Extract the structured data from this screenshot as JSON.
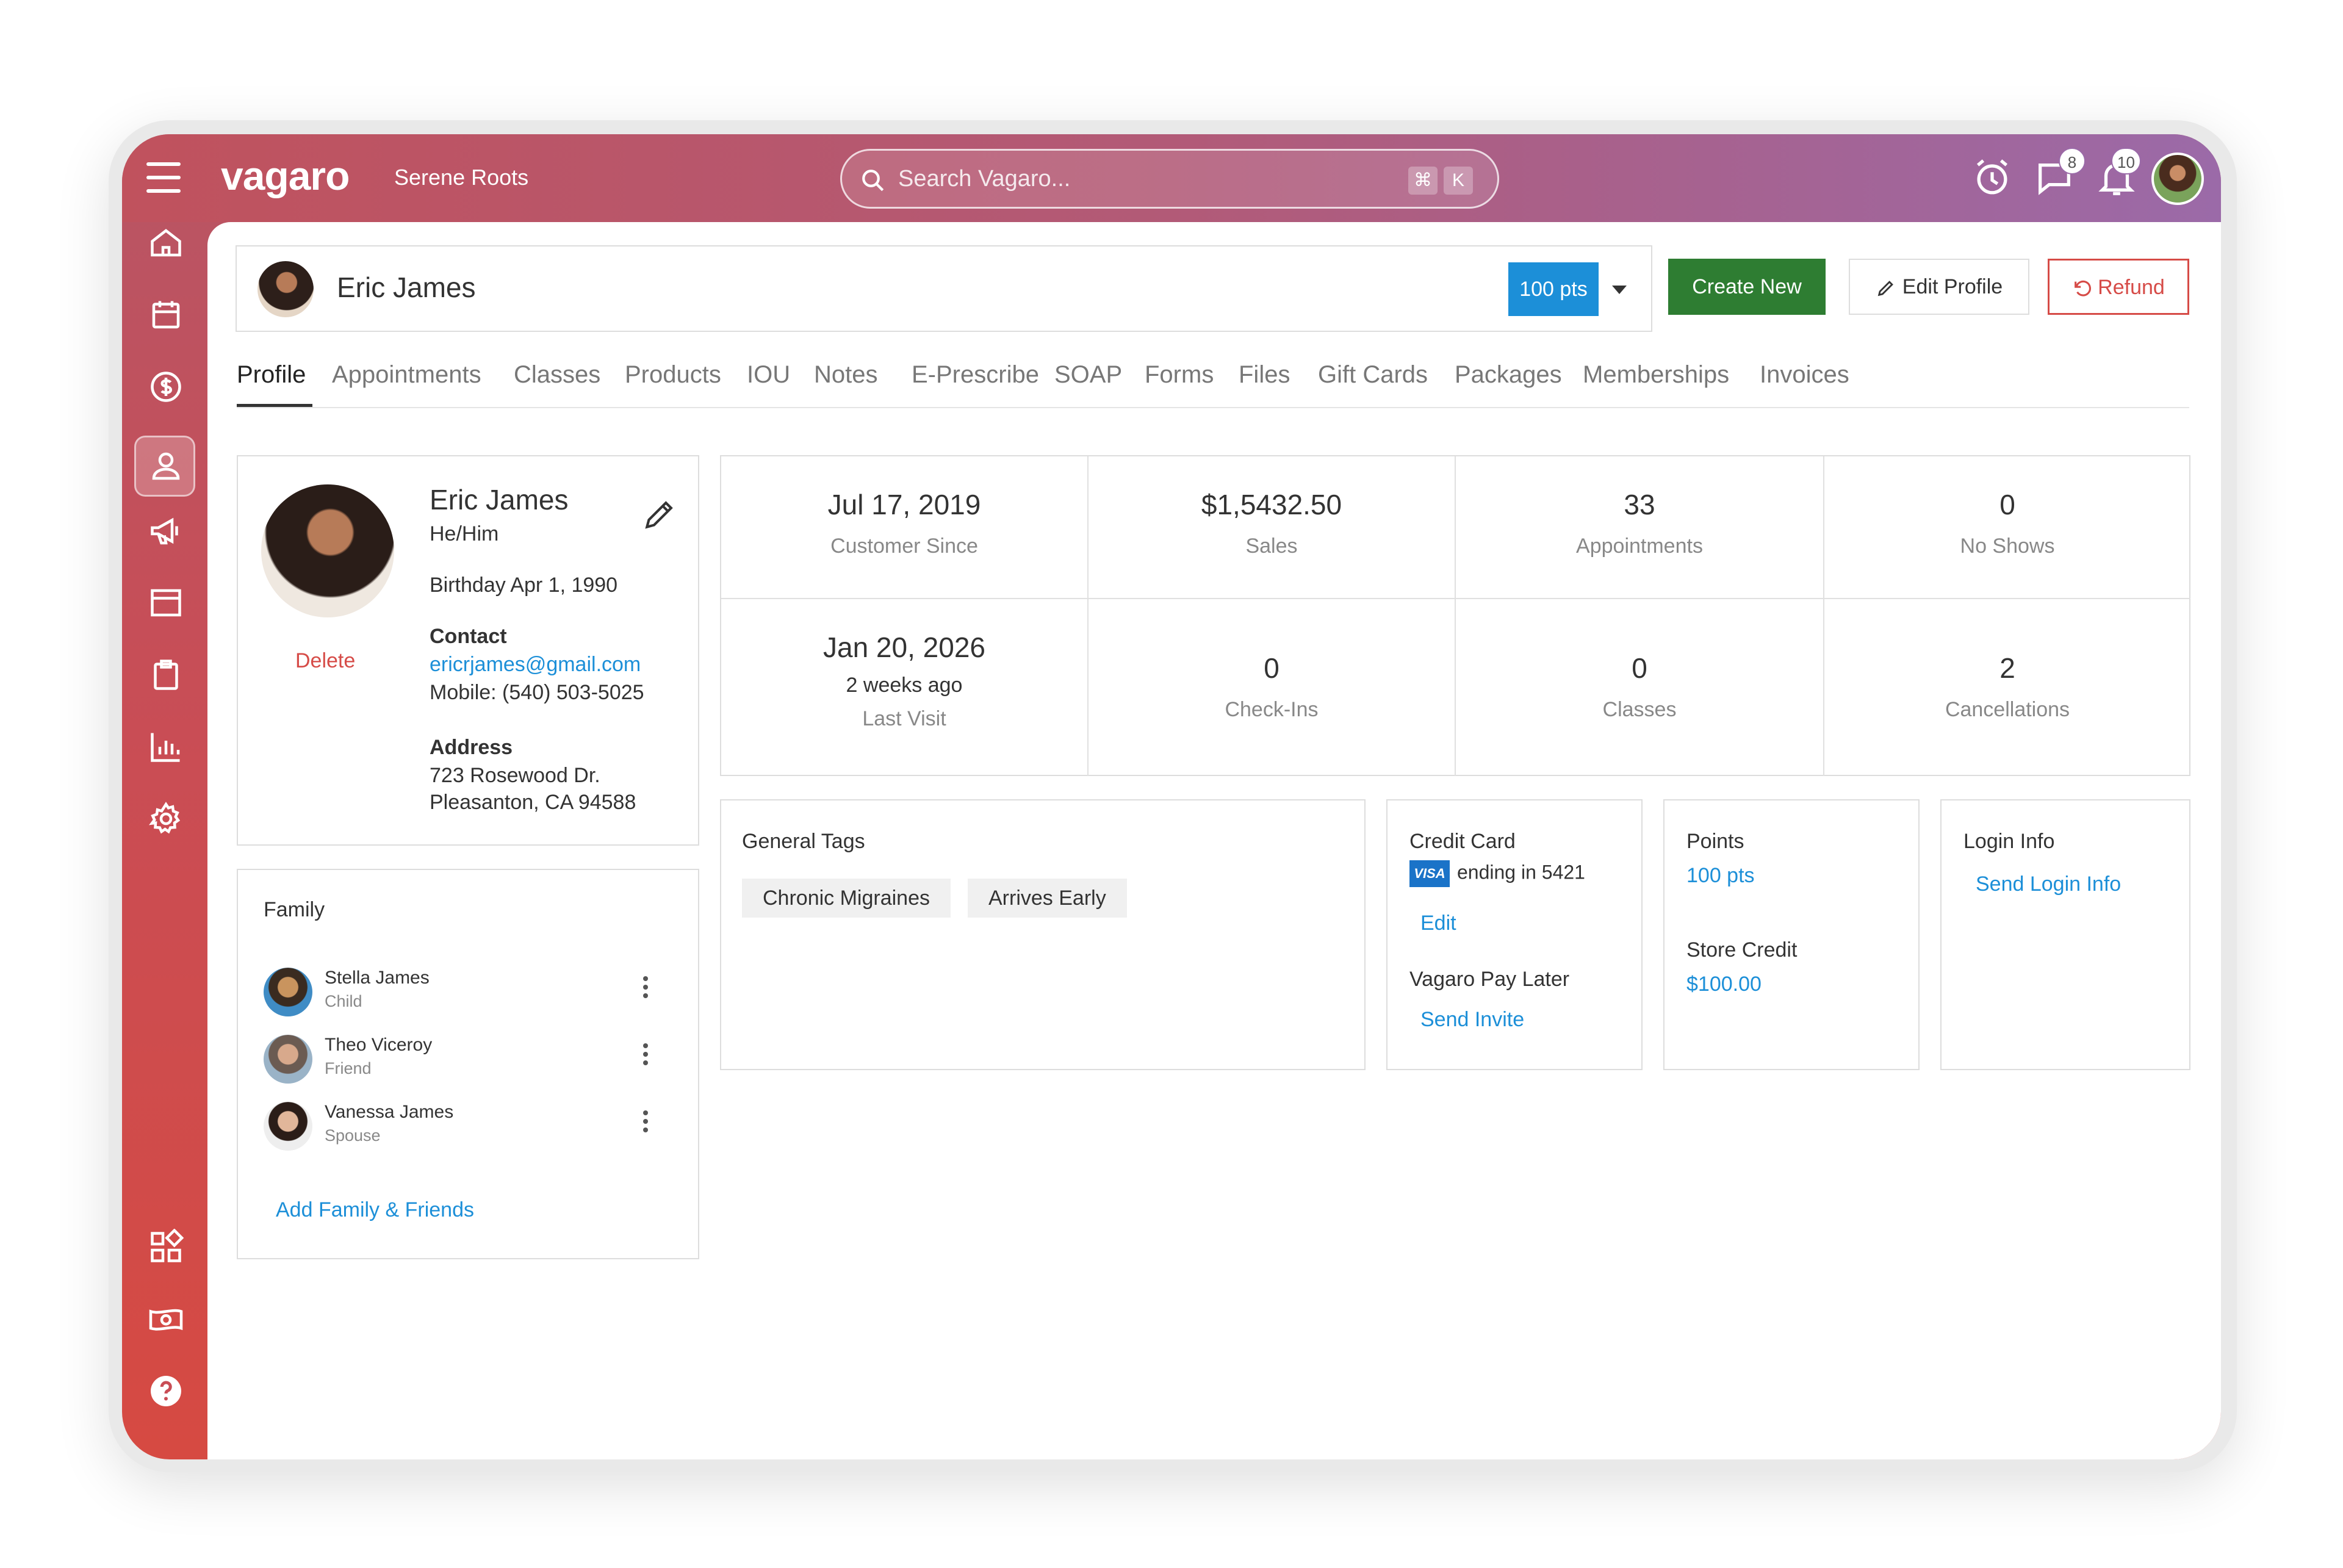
{
  "app": {
    "logo": "vagaro",
    "business_name": "Serene Roots",
    "search_placeholder": "Search Vagaro...",
    "search_shortcut": [
      "⌘",
      "K"
    ],
    "messages_count": "8",
    "notifications_count": "10"
  },
  "sidebar": {
    "items": [
      {
        "icon": "home-icon"
      },
      {
        "icon": "calendar-icon"
      },
      {
        "icon": "dollar-icon"
      },
      {
        "icon": "customer-icon",
        "active": true
      },
      {
        "icon": "megaphone-icon"
      },
      {
        "icon": "browser-window-icon"
      },
      {
        "icon": "clipboard-icon"
      },
      {
        "icon": "bar-chart-icon"
      },
      {
        "icon": "gear-icon"
      },
      {
        "icon": "apps-grid-icon"
      },
      {
        "icon": "cash-icon"
      },
      {
        "icon": "help-icon"
      }
    ]
  },
  "header": {
    "customer_name": "Eric James",
    "points_button": "100 pts",
    "create_new": "Create New",
    "edit_profile": "Edit Profile",
    "refund": "Refund"
  },
  "tabs": [
    "Profile",
    "Appointments",
    "Classes",
    "Products",
    "IOU",
    "Notes",
    "E-Prescribe",
    "SOAP",
    "Forms",
    "Files",
    "Gift Cards",
    "Packages",
    "Memberships",
    "Invoices"
  ],
  "profile": {
    "name": "Eric James",
    "pronouns": "He/Him",
    "birthday": "Birthday Apr 1, 1990",
    "delete": "Delete",
    "contact_heading": "Contact",
    "email": "ericrjames@gmail.com",
    "mobile": "Mobile: (540) 503-5025",
    "address_heading": "Address",
    "address_line1": "723 Rosewood Dr.",
    "address_line2": "Pleasanton, CA 94588"
  },
  "stats": {
    "customer_since": {
      "value": "Jul 17, 2019",
      "label": "Customer Since"
    },
    "sales": {
      "value": "$1,5432.50",
      "label": "Sales"
    },
    "appointments": {
      "value": "33",
      "label": "Appointments"
    },
    "no_shows": {
      "value": "0",
      "label": "No Shows"
    },
    "last_visit": {
      "value": "Jan 20, 2026",
      "sub": "2 weeks ago",
      "label": "Last Visit"
    },
    "check_ins": {
      "value": "0",
      "label": "Check-Ins"
    },
    "classes": {
      "value": "0",
      "label": "Classes"
    },
    "cancellations": {
      "value": "2",
      "label": "Cancellations"
    }
  },
  "tags": {
    "heading": "General Tags",
    "items": [
      "Chronic Migraines",
      "Arrives Early"
    ]
  },
  "payment": {
    "credit_card_heading": "Credit Card",
    "card_brand": "VISA",
    "card_ending": "ending in 5421",
    "edit": "Edit",
    "pay_later_heading": "Vagaro Pay Later",
    "send_invite": "Send Invite"
  },
  "points": {
    "heading": "Points",
    "value": "100 pts",
    "store_credit_heading": "Store Credit",
    "store_credit_value": "$100.00"
  },
  "login": {
    "heading": "Login Info",
    "send_login_info": "Send Login Info"
  },
  "family": {
    "heading": "Family",
    "members": [
      {
        "name": "Stella James",
        "relation": "Child"
      },
      {
        "name": "Theo Viceroy",
        "relation": "Friend"
      },
      {
        "name": "Vanessa James",
        "relation": "Spouse"
      }
    ],
    "add_link": "Add Family & Friends"
  },
  "colors": {
    "accent_blue": "#1c8fd8",
    "create_green": "#2e7d32",
    "refund_red": "#d64b47",
    "sidebar_red": "#c94d55"
  }
}
